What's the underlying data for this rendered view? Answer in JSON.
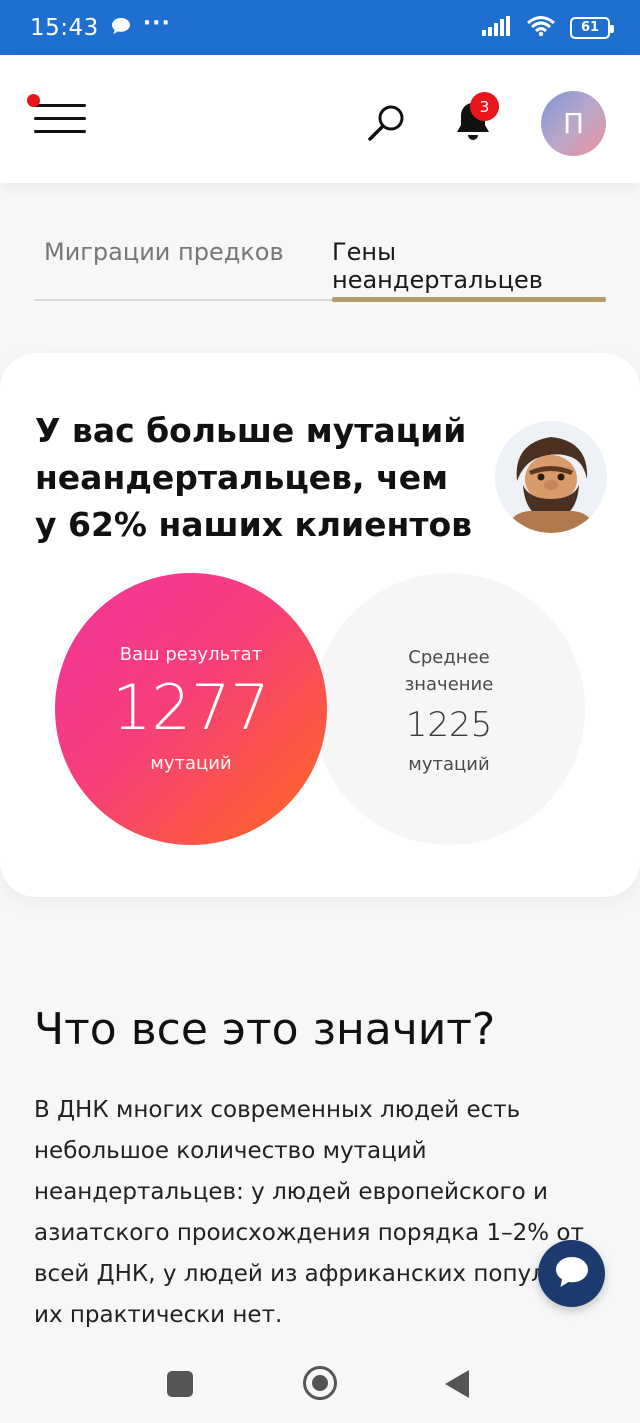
{
  "status_bar": {
    "time": "15:43",
    "dots": "···",
    "battery": "61"
  },
  "header": {
    "notification_count": "3",
    "avatar_initial": "П"
  },
  "tabs": [
    {
      "label": "Миграции предков",
      "active": false
    },
    {
      "label": "Гены неандертальцев",
      "active": true
    }
  ],
  "result_card": {
    "title": "У вас больше мутаций неандертальцев, чем у 62% наших клиентов",
    "your_result": {
      "label": "Ваш результат",
      "value": "1277",
      "unit": "мутаций"
    },
    "average": {
      "label": "Среднее значение",
      "value": "1225",
      "unit": "мутаций"
    }
  },
  "explanation": {
    "title": "Что все это значит?",
    "body": "В ДНК многих современных людей есть небольшое количество мутаций неандертальцев: у людей европейского и азиатского происхождения порядка 1–2% от всей ДНК, у людей из африканских популяций их практически нет."
  },
  "colors": {
    "status_bar": "#1f6fd1",
    "tab_underline": "#b49e6e",
    "badge": "#e8151b",
    "result_gradient_start": "#f2349c",
    "result_gradient_end": "#fe6a1c",
    "chat_button": "#1d3a6e"
  },
  "icons": {
    "menu": "hamburger-menu-icon",
    "search": "search-icon",
    "notifications": "bell-icon",
    "mascot": "neanderthal-avatar-icon",
    "chat": "chat-bubble-icon",
    "nav_recents": "square-icon",
    "nav_home": "home-circle-icon",
    "nav_back": "back-triangle-icon"
  }
}
